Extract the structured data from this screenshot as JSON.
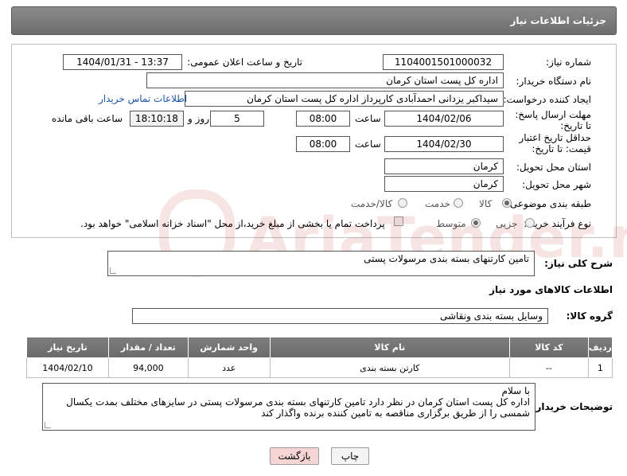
{
  "header": {
    "title": "جزئیات اطلاعات نیاز"
  },
  "form": {
    "need_number_label": "شماره نیاز:",
    "need_number": "1104001501000032",
    "announce_label": "تاریخ و ساعت اعلان عمومی:",
    "announce_value": "1404/01/31 - 13:37",
    "buyer_org_label": "نام دستگاه خریدار:",
    "buyer_org": "اداره کل پست استان کرمان",
    "requester_label": "ایجاد کننده درخواست:",
    "requester": "سیداکبر یزدانی احمدآبادی کارپرداز اداره کل پست استان کرمان",
    "contact_link": "اطلاعات تماس خریدار",
    "deadline_label": "مهلت ارسال پاسخ: تا تاریخ:",
    "deadline_date": "1404/02/06",
    "time_label": "ساعت",
    "deadline_time": "08:00",
    "days_value": "5",
    "days_label": "روز و",
    "remaining_time": "18:10:18",
    "remaining_label": "ساعت باقی مانده",
    "validity_label": "حداقل تاریخ اعتبار قیمت: تا تاریخ:",
    "validity_date": "1404/02/30",
    "validity_time": "08:00",
    "province_label": "استان محل تحویل:",
    "province": "کرمان",
    "city_label": "شهر محل تحویل:",
    "city": "کرمان",
    "category_label": "طبقه بندی موضوعی:",
    "category_options": [
      "کالا",
      "خدمت",
      "کالا/خدمت"
    ],
    "purchase_type_label": "نوع فرآیند خرید :",
    "purchase_options": [
      "جزیی",
      "متوسط"
    ],
    "payment_note": "پرداخت تمام یا بخشی از مبلغ خرید،از محل \"اسناد خزانه اسلامی\" خواهد بود."
  },
  "summary": {
    "label": "شرح کلی نیاز:",
    "value": "تامین کارتنهای بسته بندی مرسولات پستی"
  },
  "goods_section": {
    "title": "اطلاعات کالاهای مورد نیاز",
    "group_label": "گروه کالا:",
    "group_value": "وسایل بسته بندی  ونقاشی"
  },
  "table": {
    "headers": [
      "ردیف",
      "کد کالا",
      "نام کالا",
      "واحد شمارش",
      "تعداد / مقدار",
      "تاریخ نیاز"
    ],
    "rows": [
      [
        "1",
        "--",
        "کارتن بسته بندی",
        "عدد",
        "94,000",
        "1404/02/10"
      ]
    ]
  },
  "buyer_notes": {
    "label": "توضیحات خریدار:",
    "line1": "با سلام",
    "line2": "اداره کل پست استان کرمان در نظر دارد تامین کارتنهای بسته بندی مرسولات پستی در سایزهای مختلف بمدت یکسال",
    "line3": "شمسی را از طریق برگزاری مناقصه به تامین کننده برنده واگذار کند"
  },
  "buttons": {
    "print": "چاپ",
    "back": "بازگشت"
  },
  "watermark": {
    "text": "AriaTender.neT"
  },
  "colors": {
    "header_bg": "#7a7a7a",
    "link": "#1a55a8",
    "back_button_bg": "#f6d5d5"
  }
}
